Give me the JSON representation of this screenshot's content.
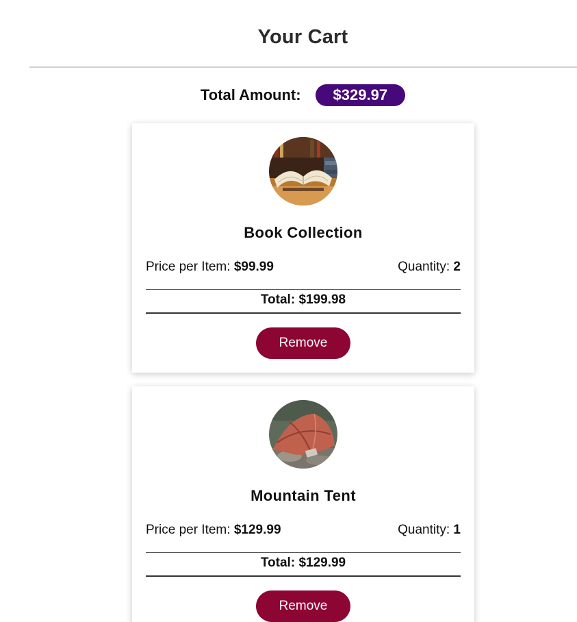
{
  "header": {
    "title": "Your Cart"
  },
  "summary": {
    "total_label": "Total Amount:",
    "total_value": "$329.97"
  },
  "items": [
    {
      "name": "Book Collection",
      "price_label": "Price per Item:",
      "price": "$99.99",
      "quantity_label": "Quantity:",
      "quantity": "2",
      "total_text": "Total: $199.98",
      "remove_label": "Remove",
      "image_icon": "book-photo"
    },
    {
      "name": "Mountain Tent",
      "price_label": "Price per Item:",
      "price": "$129.99",
      "quantity_label": "Quantity:",
      "quantity": "1",
      "total_text": "Total: $129.99",
      "remove_label": "Remove",
      "image_icon": "tent-photo"
    }
  ],
  "colors": {
    "badge": "#46097a",
    "remove_button": "#8d0532"
  }
}
